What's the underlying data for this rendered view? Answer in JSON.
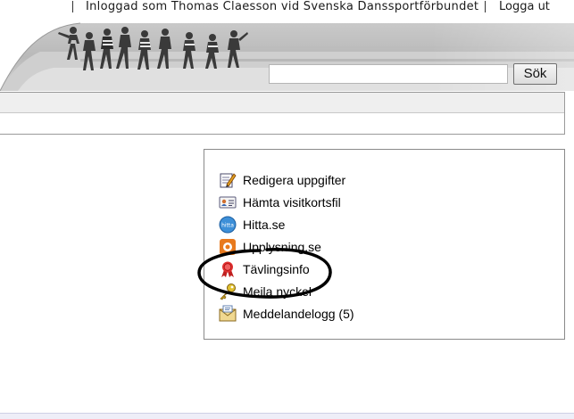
{
  "header": {
    "user_text": "Inloggad som Thomas Claesson vid Svenska Danssportförbundet",
    "logout_label": "Logga ut"
  },
  "search": {
    "value": "",
    "placeholder": "",
    "button_label": "Sök"
  },
  "actions": [
    {
      "label": "Redigera uppgifter",
      "icon": "edit-icon"
    },
    {
      "label": "Hämta visitkortsfil",
      "icon": "vcard-icon"
    },
    {
      "label": "Hitta.se",
      "icon": "hitta-icon"
    },
    {
      "label": "Upplysning.se",
      "icon": "upplysning-icon"
    },
    {
      "label": "Tävlingsinfo",
      "icon": "award-ribbon-icon"
    },
    {
      "label": "Meila nyckel",
      "icon": "key-icon"
    },
    {
      "label": "Meddelandelogg (5)",
      "icon": "message-log-icon"
    }
  ],
  "colors": {
    "annotation": "#000000",
    "panel_border": "#8a8a8a"
  }
}
